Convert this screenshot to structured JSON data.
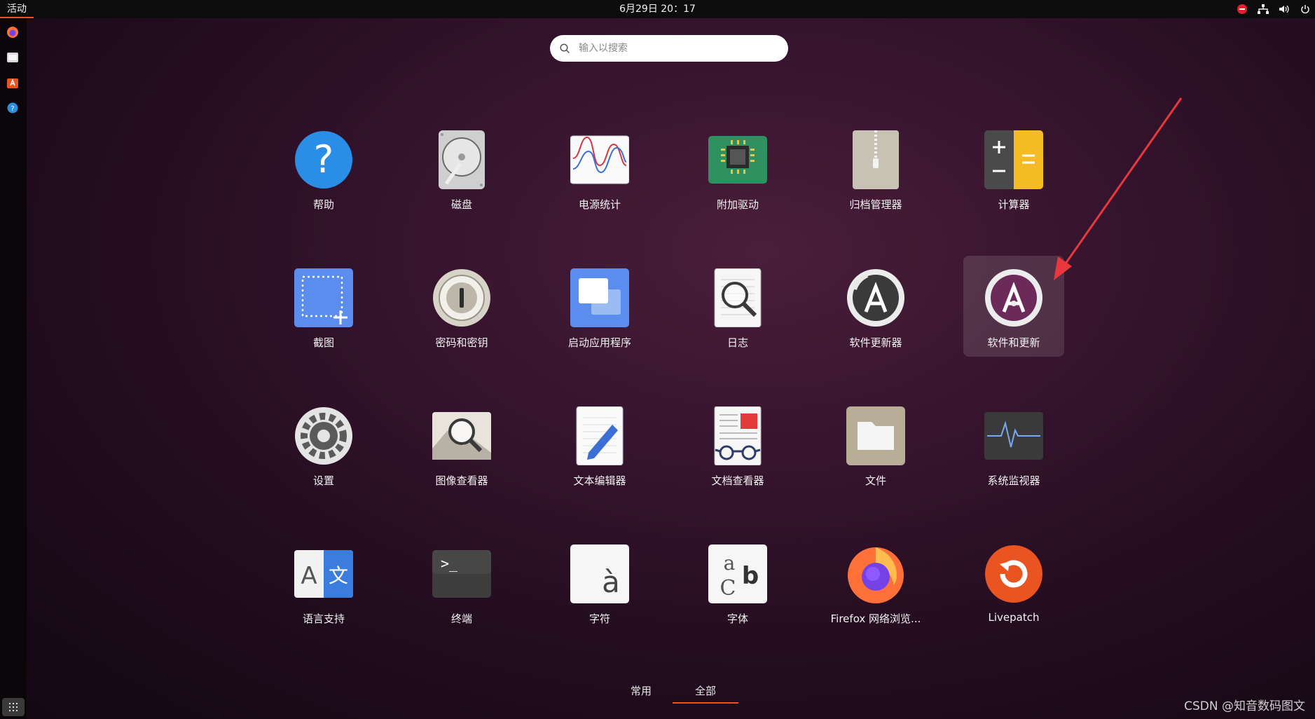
{
  "topbar": {
    "activities": "活动",
    "clock": "6月29日  20：17",
    "tray_icons": [
      "do-not-disturb-icon",
      "network-icon",
      "volume-icon",
      "power-icon"
    ]
  },
  "dock": {
    "items": [
      "firefox-icon",
      "files-icon",
      "software-center-icon",
      "help-icon"
    ],
    "show_apps": "show-apps-grid-icon"
  },
  "search": {
    "placeholder": "输入以搜索",
    "value": ""
  },
  "apps": [
    {
      "label": "帮助",
      "icon": "help-icon"
    },
    {
      "label": "磁盘",
      "icon": "disks-icon"
    },
    {
      "label": "电源统计",
      "icon": "power-statistics-icon"
    },
    {
      "label": "附加驱动",
      "icon": "additional-drivers-icon"
    },
    {
      "label": "归档管理器",
      "icon": "archive-manager-icon"
    },
    {
      "label": "计算器",
      "icon": "calculator-icon"
    },
    {
      "label": "截图",
      "icon": "screenshot-icon"
    },
    {
      "label": "密码和密钥",
      "icon": "passwords-keys-icon"
    },
    {
      "label": "启动应用程序",
      "icon": "startup-applications-icon"
    },
    {
      "label": "日志",
      "icon": "logs-icon"
    },
    {
      "label": "软件更新器",
      "icon": "software-updater-icon"
    },
    {
      "label": "软件和更新",
      "icon": "software-properties-icon"
    },
    {
      "label": "设置",
      "icon": "settings-icon"
    },
    {
      "label": "图像查看器",
      "icon": "image-viewer-icon"
    },
    {
      "label": "文本编辑器",
      "icon": "text-editor-icon"
    },
    {
      "label": "文档查看器",
      "icon": "document-viewer-icon"
    },
    {
      "label": "文件",
      "icon": "files-icon"
    },
    {
      "label": "系统监视器",
      "icon": "system-monitor-icon"
    },
    {
      "label": "语言支持",
      "icon": "language-support-icon"
    },
    {
      "label": "终端",
      "icon": "terminal-icon"
    },
    {
      "label": "字符",
      "icon": "characters-icon"
    },
    {
      "label": "字体",
      "icon": "fonts-icon"
    },
    {
      "label": "Firefox 网络浏览...",
      "icon": "firefox-icon"
    },
    {
      "label": "Livepatch",
      "icon": "livepatch-icon"
    }
  ],
  "view_toggle": {
    "frequent": "常用",
    "all": "全部",
    "selected": "全部"
  },
  "watermark": "CSDN @知音数码图文",
  "colors": {
    "accent": "#e95420",
    "arrow": "#e8383d"
  }
}
